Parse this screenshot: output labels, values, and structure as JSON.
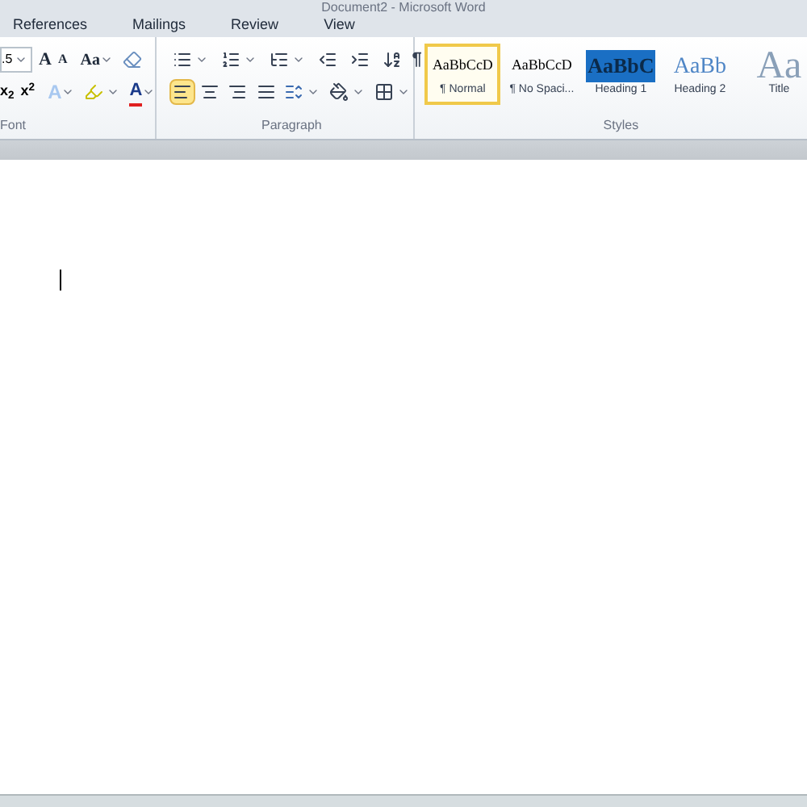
{
  "window": {
    "title": "Document2 - Microsoft Word"
  },
  "tabs": [
    {
      "label": "References"
    },
    {
      "label": "Mailings"
    },
    {
      "label": "Review"
    },
    {
      "label": "View"
    }
  ],
  "font_group": {
    "label": "Font",
    "size": ".5",
    "grow": "A",
    "shrink": "A",
    "change_case": "Aa",
    "subscript": "x$_{2}$",
    "superscript": "x$^{2}$",
    "text_effects": "A",
    "font_color": "A"
  },
  "paragraph_group": {
    "label": "Paragraph",
    "pilcrow": "¶",
    "alignments": [
      {
        "kind": "left",
        "selected": true
      },
      {
        "kind": "center",
        "selected": false
      },
      {
        "kind": "right",
        "selected": false
      },
      {
        "kind": "justify",
        "selected": false
      }
    ]
  },
  "styles_group": {
    "label": "Styles",
    "items": [
      {
        "sample": "AaBbCcD",
        "label": "¶ Normal",
        "kind": "normal",
        "selected": true
      },
      {
        "sample": "AaBbCcD",
        "label": "¶ No Spaci...",
        "kind": "normal",
        "selected": false
      },
      {
        "sample": "AaBbC",
        "label": "Heading 1",
        "kind": "heading1",
        "selected": false
      },
      {
        "sample": "AaBb",
        "label": "Heading 2",
        "kind": "heading2",
        "selected": false
      },
      {
        "sample": "Aa",
        "label": "Title",
        "kind": "title",
        "selected": false
      }
    ]
  }
}
